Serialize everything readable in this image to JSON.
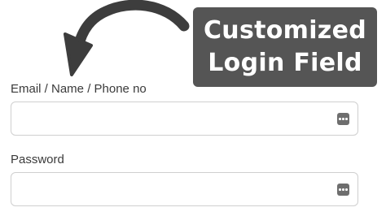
{
  "callout": {
    "line1": "Customized",
    "line2": "Login Field"
  },
  "form": {
    "email_label": "Email / Name / Phone no",
    "email_value": "",
    "password_label": "Password",
    "password_value": ""
  },
  "icons": {
    "field_icon": "password-manager-icon",
    "arrow": "curved-arrow-icon"
  },
  "colors": {
    "callout_background": "#555555",
    "callout_text": "#ffffff",
    "arrow": "#3d3d3d",
    "field_border": "#cfcfcf",
    "label_text": "#3a3a3a"
  }
}
